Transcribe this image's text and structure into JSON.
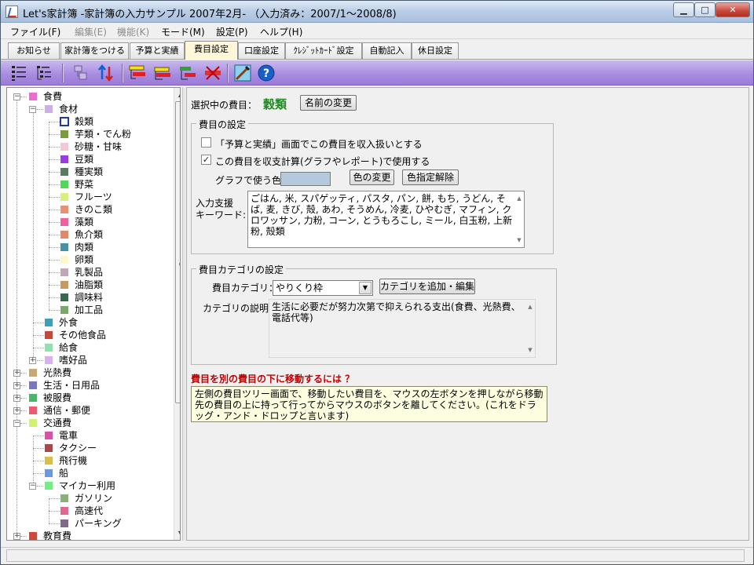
{
  "window": {
    "title": "Let's家計簿  -家計簿の入力サンプル 2007年2月-  （入力済み：2007/1～2008/8)",
    "min_glyph": "▁",
    "max_glyph": "□",
    "close_glyph": "✕"
  },
  "menubar": [
    {
      "label": "ファイル(F)",
      "enabled": true
    },
    {
      "label": "編集(E)",
      "enabled": false
    },
    {
      "label": "機能(K)",
      "enabled": false
    },
    {
      "label": "モード(M)",
      "enabled": true
    },
    {
      "label": "設定(P)",
      "enabled": true
    },
    {
      "label": "ヘルプ(H)",
      "enabled": true
    }
  ],
  "tabs": [
    {
      "label": "お知らせ",
      "active": false
    },
    {
      "label": "家計簿をつける",
      "active": false
    },
    {
      "label": "予算と実績",
      "active": false
    },
    {
      "label": "費目設定",
      "active": true
    },
    {
      "label": "口座設定",
      "active": false
    },
    {
      "label": "ｸﾚｼﾞｯﾄｶｰﾄﾞ設定",
      "active": false
    },
    {
      "label": "自動記入",
      "active": false
    },
    {
      "label": "休日設定",
      "active": false
    }
  ],
  "toolbar_icons": [
    "collapse-tree-icon",
    "expand-tree-icon",
    "move-item-icon",
    "sort-updown-icon",
    "add-item-top-icon",
    "add-item-mid-icon",
    "add-item-sub-icon",
    "delete-item-icon",
    "edit-color-icon",
    "help-icon"
  ],
  "tree": [
    {
      "label": "食費",
      "color": "#f06bd1",
      "level": 0,
      "exp": "−"
    },
    {
      "label": "食材",
      "color": "#cbb0e6",
      "level": 1,
      "exp": "−"
    },
    {
      "label": "穀類",
      "color": "#ffffff",
      "level": 2,
      "selected": true
    },
    {
      "label": "芋類・でん粉",
      "color": "#7a9a3c",
      "level": 2
    },
    {
      "label": "砂糖・甘味",
      "color": "#f2c8d8",
      "level": 2
    },
    {
      "label": "豆類",
      "color": "#9a3ce0",
      "level": 2
    },
    {
      "label": "種実類",
      "color": "#5a7a64",
      "level": 2
    },
    {
      "label": "野菜",
      "color": "#50d858",
      "level": 2
    },
    {
      "label": "フルーツ",
      "color": "#d8f080",
      "level": 2
    },
    {
      "label": "きのこ類",
      "color": "#e89070",
      "level": 2
    },
    {
      "label": "藻類",
      "color": "#f060a0",
      "level": 2
    },
    {
      "label": "魚介類",
      "color": "#e08868",
      "level": 2
    },
    {
      "label": "肉類",
      "color": "#4890a8",
      "level": 2
    },
    {
      "label": "卵類",
      "color": "#fff8c8",
      "level": 2
    },
    {
      "label": "乳製品",
      "color": "#c0a8b8",
      "level": 2
    },
    {
      "label": "油脂類",
      "color": "#c89860",
      "level": 2
    },
    {
      "label": "調味料",
      "color": "#386850",
      "level": 2
    },
    {
      "label": "加工品",
      "color": "#7aa868",
      "level": 2
    },
    {
      "label": "外食",
      "color": "#3ca0b8",
      "level": 1
    },
    {
      "label": "その他食品",
      "color": "#c84838",
      "level": 1
    },
    {
      "label": "給食",
      "color": "#90e0b0",
      "level": 1
    },
    {
      "label": "嗜好品",
      "color": "#dab0f0",
      "level": 1,
      "exp": "+"
    },
    {
      "label": "光熱費",
      "color": "#c8a870",
      "level": 0,
      "exp": "+"
    },
    {
      "label": "生活・日用品",
      "color": "#7878c0",
      "level": 0,
      "exp": "+"
    },
    {
      "label": "被服費",
      "color": "#48b868",
      "level": 0,
      "exp": "+"
    },
    {
      "label": "通信・郵便",
      "color": "#f05870",
      "level": 0,
      "exp": "+"
    },
    {
      "label": "交通費",
      "color": "#d0f070",
      "level": 0,
      "exp": "−"
    },
    {
      "label": "電車",
      "color": "#d850a8",
      "level": 1
    },
    {
      "label": "タクシー",
      "color": "#a84848",
      "level": 1
    },
    {
      "label": "飛行機",
      "color": "#d8c048",
      "level": 1
    },
    {
      "label": "船",
      "color": "#6898e0",
      "level": 1
    },
    {
      "label": "マイカー利用",
      "color": "#70f080",
      "level": 1,
      "exp": "−"
    },
    {
      "label": "ガソリン",
      "color": "#88b078",
      "level": 2
    },
    {
      "label": "高速代",
      "color": "#e06890",
      "level": 2
    },
    {
      "label": "パーキング",
      "color": "#806888",
      "level": 2
    },
    {
      "label": "教育費",
      "color": "#d04838",
      "level": 0,
      "exp": "+"
    }
  ],
  "selected": {
    "prefix": "選択中の費目：",
    "name": "穀類",
    "rename_button": "名前の変更"
  },
  "item_settings": {
    "title": "費目の設定",
    "check_budget": {
      "label": "「予算と実績」画面でこの費目を収入扱いとする",
      "checked": false
    },
    "check_use": {
      "label": "この費目を収支計算(グラフやレポート)で使用する",
      "checked": true
    },
    "graph_color_label": "グラフで使う色:",
    "graph_color": "#b4c9dc",
    "color_change_button": "色の変更",
    "color_clear_button": "色指定解除",
    "keyword_label": "入力支援\nキーワード:",
    "keywords": "ごはん, 米, スパゲッティ, パスタ, パン, 餅, もち, うどん, そば, 麦, きび, 殻, あわ, そうめん, 冷麦, ひやむぎ, マフィン, クロワッサン, 力粉, コーン, とうもろこし, ミール, 白玉粉, 上新粉, 殻類"
  },
  "category_settings": {
    "title": "費目カテゴリの設定",
    "category_label": "費目カテゴリ：",
    "category_value": "やりくり枠",
    "add_edit_button": "カテゴリを追加・編集",
    "desc_label": "カテゴリの説明:",
    "desc": "生活に必要だが努力次第で抑えられる支出(食費、光熱費、電話代等)"
  },
  "help": {
    "heading": "費目を別の費目の下に移動するには ？",
    "text": "左側の費目ツリー画面で、移動したい費目を、マウスの左ボタンを押しながら移動先の費目の上に持って行ってからマウスのボタンを離してください。(これをドラッグ・アンド・ドロップと言います)"
  },
  "colors": {
    "selected_name": "#1f8a1f",
    "help_heading": "#c00000",
    "toolbar_bg": "#a78ae0"
  }
}
